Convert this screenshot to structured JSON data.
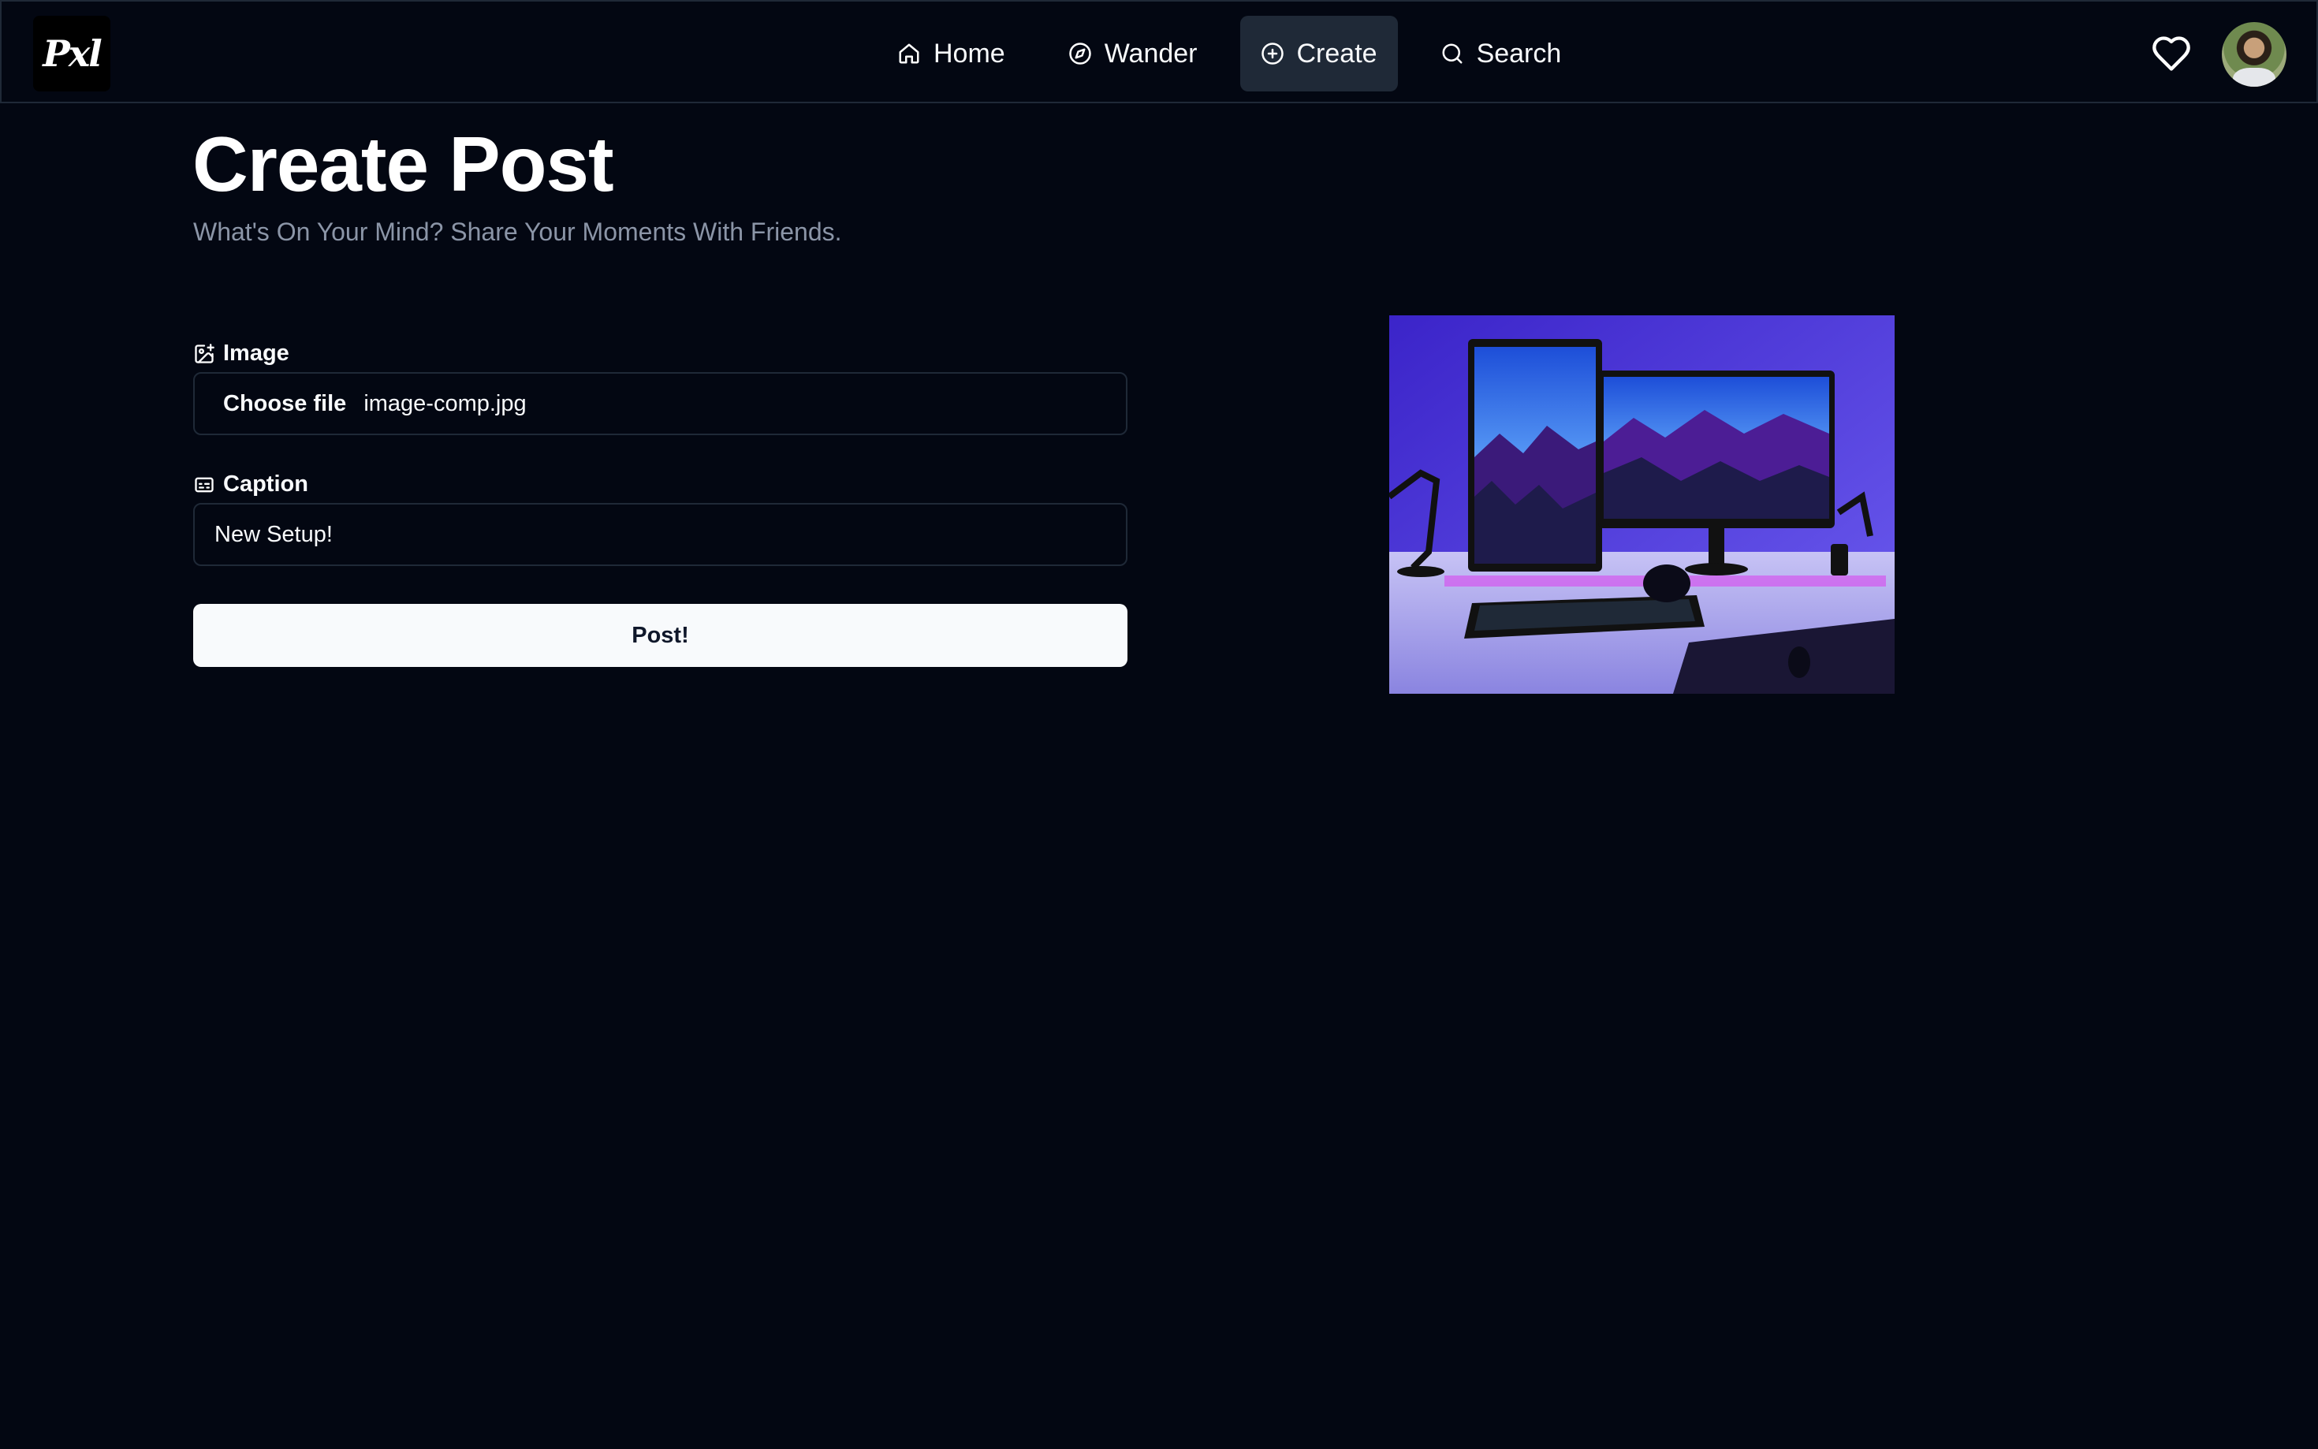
{
  "app": {
    "logo_text": "Pxl"
  },
  "nav": {
    "items": [
      {
        "label": "Home",
        "icon": "home-icon",
        "active": false
      },
      {
        "label": "Wander",
        "icon": "compass-icon",
        "active": false
      },
      {
        "label": "Create",
        "icon": "plus-circle-icon",
        "active": true
      },
      {
        "label": "Search",
        "icon": "search-icon",
        "active": false
      }
    ]
  },
  "header_actions": {
    "likes_icon": "heart-icon",
    "avatar_icon": "user-avatar"
  },
  "page": {
    "title": "Create Post",
    "subtitle": "What's On Your Mind? Share Your Moments With Friends."
  },
  "form": {
    "image_label": "Image",
    "file_button": "Choose file",
    "file_name": "image-comp.jpg",
    "caption_label": "Caption",
    "caption_value": "New Setup!",
    "submit_label": "Post!"
  },
  "colors": {
    "background": "#030712",
    "active_nav": "#1f2937",
    "border": "#1f2937",
    "button_bg": "#f8fafc",
    "muted_text": "#8b95a7"
  }
}
